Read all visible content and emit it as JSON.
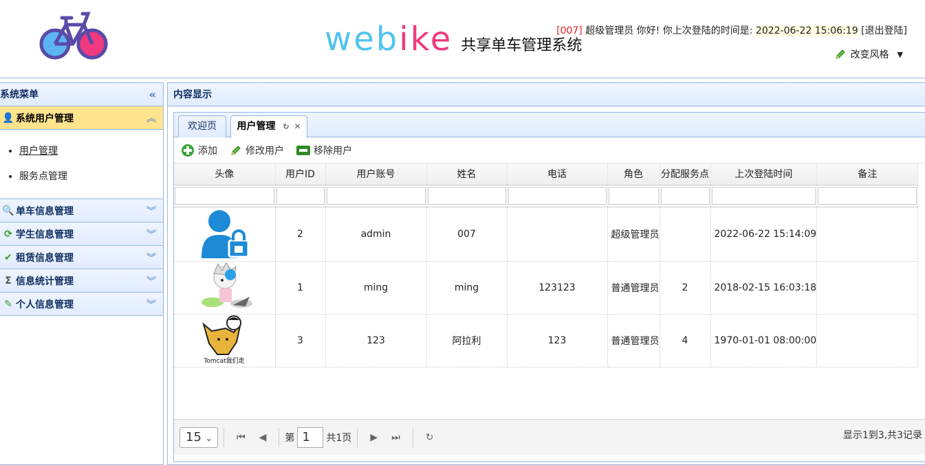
{
  "header": {
    "brand_part1": "web",
    "brand_part2": "ike",
    "brand_sub": "共享单车管理系统",
    "user_code": "[007]",
    "greeting": "超级管理员 你好! 你上次登陆的时间是:",
    "last_login": "2022-06-22 15:06:19",
    "logout": "[退出登陆]",
    "style_switch": "改变风格",
    "colors": {
      "brand_blue": "#52c4ee",
      "brand_pink": "#f0397e"
    }
  },
  "sidebar": {
    "title": "系统菜单",
    "sections": [
      {
        "label": "系统用户管理",
        "icon": "user-icon",
        "active": true
      },
      {
        "label": "单车信息管理",
        "icon": "search-icon"
      },
      {
        "label": "学生信息管理",
        "icon": "refresh-icon"
      },
      {
        "label": "租赁信息管理",
        "icon": "check-icon"
      },
      {
        "label": "信息统计管理",
        "icon": "sigma-icon"
      },
      {
        "label": "个人信息管理",
        "icon": "pencil-icon"
      }
    ],
    "active_items": [
      "用户管理",
      "服务点管理"
    ]
  },
  "content": {
    "title": "内容显示",
    "tabs": [
      {
        "label": "欢迎页"
      },
      {
        "label": "用户管理",
        "selected": true
      }
    ],
    "toolbar": {
      "add": "添加",
      "edit": "修改用户",
      "remove": "移除用户"
    },
    "columns": [
      "头像",
      "用户ID",
      "用户账号",
      "姓名",
      "电话",
      "角色",
      "分配服务点",
      "上次登陆时间",
      "备注"
    ],
    "rows": [
      {
        "avatar": "user-lock-avatar",
        "id": "2",
        "account": "admin",
        "name": "007",
        "phone": "",
        "role": "超级管理员",
        "station": "",
        "last_login": "2022-06-22 15:14:09",
        "note": ""
      },
      {
        "avatar": "anime-avatar",
        "id": "1",
        "account": "ming",
        "name": "ming",
        "phone": "123123",
        "role": "普通管理员",
        "station": "2",
        "last_login": "2018-02-15 16:03:18",
        "note": ""
      },
      {
        "avatar": "tomcat-avatar",
        "id": "3",
        "account": "123",
        "name": "阿拉利",
        "phone": "123",
        "role": "普通管理员",
        "station": "4",
        "last_login": "1970-01-01 08:00:00",
        "note": ""
      }
    ],
    "tomcat_caption": "Tomcat我们走",
    "pager": {
      "page_size": "15",
      "page_prefix": "第",
      "page": "1",
      "page_suffix": "共1页",
      "info": "显示1到3,共3记录"
    }
  }
}
